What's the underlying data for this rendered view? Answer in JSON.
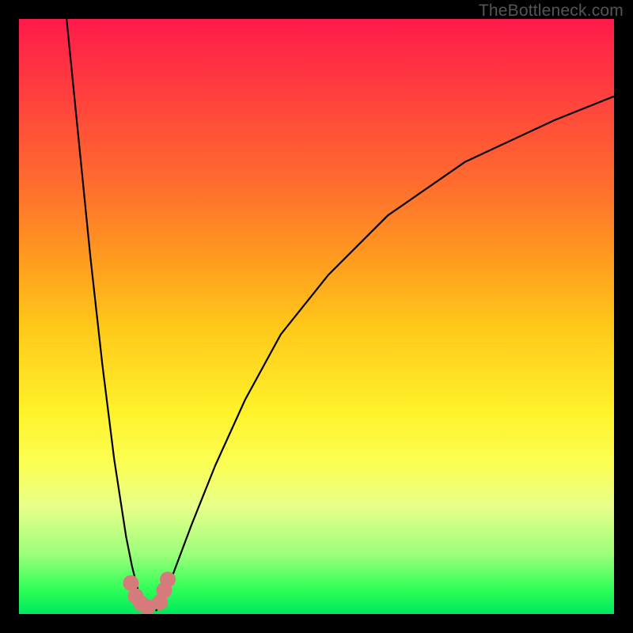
{
  "watermark": "TheBottleneck.com",
  "chart_data": {
    "type": "line",
    "title": "",
    "xlabel": "",
    "ylabel": "",
    "xlim": [
      0,
      100
    ],
    "ylim": [
      0,
      100
    ],
    "grid": false,
    "legend": false,
    "series": [
      {
        "name": "left-branch",
        "x": [
          8,
          10,
          12,
          14,
          16,
          18,
          19,
          20,
          20.5,
          21,
          22
        ],
        "y": [
          100,
          80,
          60,
          42,
          26,
          13,
          8,
          4,
          2.5,
          1.5,
          0.5
        ]
      },
      {
        "name": "right-branch",
        "x": [
          23,
          24,
          26,
          29,
          33,
          38,
          44,
          52,
          62,
          75,
          90,
          100
        ],
        "y": [
          0.5,
          2,
          7,
          15,
          25,
          36,
          47,
          57,
          67,
          76,
          83,
          87
        ]
      }
    ],
    "markers": [
      {
        "name": "pink-dot",
        "x": 18.8,
        "y": 5.2
      },
      {
        "name": "pink-dot",
        "x": 19.6,
        "y": 3.0
      },
      {
        "name": "pink-dot",
        "x": 20.5,
        "y": 1.8
      },
      {
        "name": "pink-dot",
        "x": 21.6,
        "y": 1.2
      },
      {
        "name": "pink-dot",
        "x": 23.7,
        "y": 2.0
      },
      {
        "name": "pink-dot",
        "x": 24.4,
        "y": 4.0
      },
      {
        "name": "pink-dot",
        "x": 25.0,
        "y": 5.8
      }
    ],
    "marker_color": "#d67b7b",
    "marker_radius_px": 10,
    "stroke_color": "#000000",
    "stroke_width_px": 2.2
  }
}
